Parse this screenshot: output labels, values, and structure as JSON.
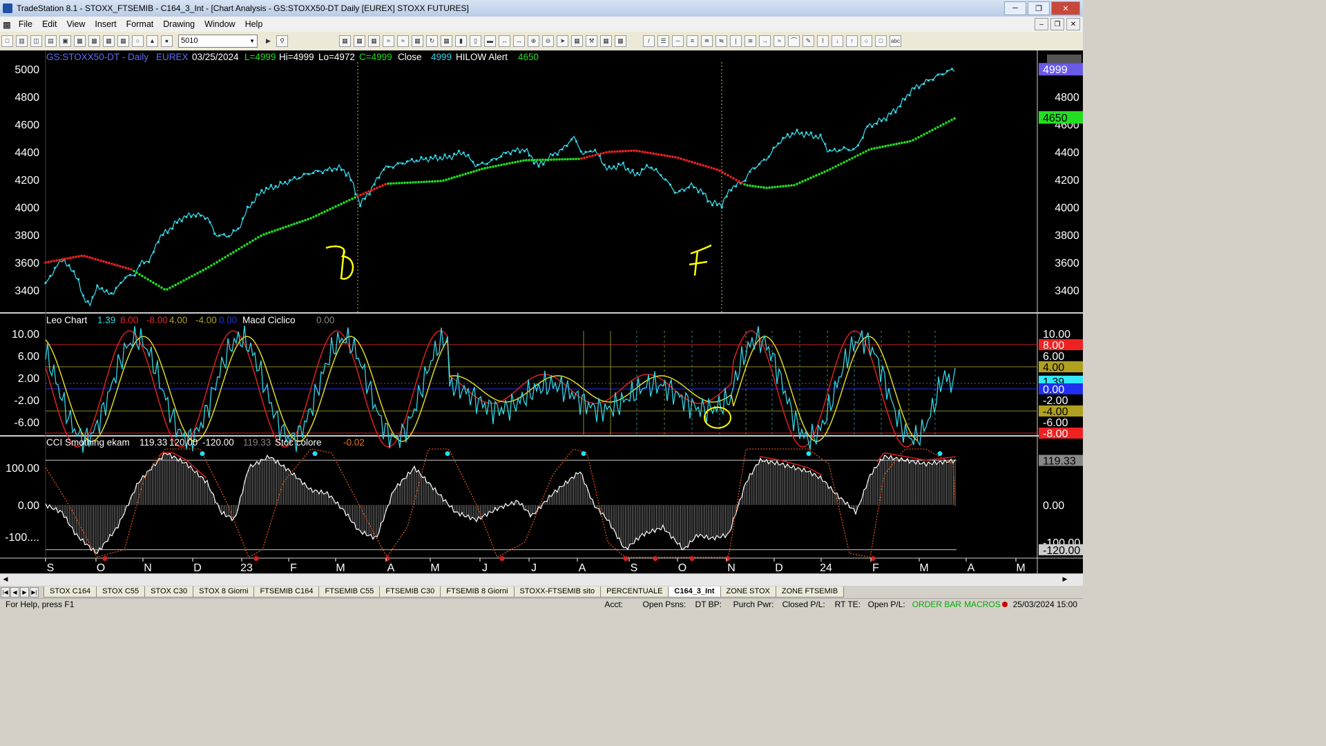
{
  "window": {
    "title": "TradeStation 8.1 - STOXX_FTSEMIB - C164_3_Int - [Chart Analysis - GS:STOXX50-DT  Daily  [EUREX] STOXX FUTURES]"
  },
  "menu": [
    "File",
    "Edit",
    "View",
    "Insert",
    "Format",
    "Drawing",
    "Window",
    "Help"
  ],
  "toolbar": {
    "symbol_value": "5010"
  },
  "price_pane": {
    "header": {
      "symbol": "GS:STOXX50-DT - Daily",
      "exchange": "EUREX",
      "date": "03/25/2024",
      "low_label": "L=4999",
      "hi": "Hi=4999",
      "lo": "Lo=4972",
      "close_label": "C=4999",
      "close_word": "Close",
      "close_value": "4999",
      "indicator": "HILOW Alert",
      "indicator_value": "4650"
    },
    "y_ticks": [
      "5000",
      "4800",
      "4600",
      "4400",
      "4200",
      "4000",
      "3800",
      "3600",
      "3400"
    ],
    "last_price": "4999",
    "alert_level": "4650",
    "annotations": [
      "B",
      "F"
    ]
  },
  "macd_pane": {
    "header": {
      "name": "Leo Chart",
      "v1": "1.39",
      "v2": "8.00",
      "v3": "-8.00",
      "v4": "4.00",
      "v5": "-4.00",
      "v6": "0.00",
      "name2": "Macd Ciclico",
      "v7": "0.00"
    },
    "y_ticks": [
      "10.00",
      "6.00",
      "2.00",
      "-2.00",
      "-6.00"
    ],
    "badges": [
      "10.00",
      "8.00",
      "6.00",
      "4.00",
      "1.39",
      "0.00",
      "-2.00",
      "-4.00",
      "-6.00",
      "-8.00"
    ]
  },
  "cci_pane": {
    "header": {
      "name": "CCI Smothing ekam",
      "v1": "119.33",
      "v2": "120.00",
      "v3": "-120.00",
      "v4": "119.33",
      "name2": "Stoc colore",
      "v5": "-0.02"
    },
    "y_ticks": [
      "100.00",
      "0.00",
      "-100...."
    ],
    "badges": [
      "119.33",
      "0.00",
      "-100.00",
      "-120.00"
    ]
  },
  "x_axis": [
    "S",
    "O",
    "N",
    "D",
    "23",
    "F",
    "M",
    "A",
    "M",
    "J",
    "J",
    "A",
    "S",
    "O",
    "N",
    "D",
    "24",
    "F",
    "M",
    "A",
    "M"
  ],
  "tabs": [
    "STOX C164",
    "STOX C55",
    "STOX  C30",
    "STOX  8 Giorni",
    "FTSEMIB C164",
    "FTSEMIB C55",
    "FTSEMIB C30",
    "FTSEMIB  8 Giorni",
    "STOXX-FTSEMIB sito",
    "PERCENTUALE",
    "C164_3_Int",
    "ZONE STOX",
    "ZONE FTSEMIB"
  ],
  "active_tab": "C164_3_Int",
  "status": {
    "help": "For Help, press F1",
    "acct": "Acct:",
    "open_psns": "Open Psns:",
    "dt_bp": "DT BP:",
    "purch_pwr": "Purch Pwr:",
    "closed_pl": "Closed P/L:",
    "rt_te": "RT TE:",
    "open_pl": "Open P/L:",
    "order_bar": "ORDER BAR",
    "macros": "MACROS",
    "datetime": "25/03/2024 15:00"
  },
  "colors": {
    "price": "#33d6e6",
    "ma_up": "#22dd22",
    "ma_down": "#ee2222",
    "cyan_marker": "#22e0f0",
    "annotation": "#ffff00"
  }
}
